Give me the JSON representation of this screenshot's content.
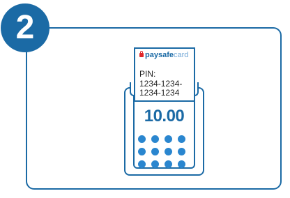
{
  "step": {
    "number": "2"
  },
  "receipt": {
    "logo_bold": "paysafe",
    "logo_light": "card",
    "pin_label": "PIN:",
    "pin_value": "1234-1234-\n1234-1234"
  },
  "terminal": {
    "amount": "10.00",
    "keypad_keys": 12
  },
  "colors": {
    "primary": "#1b6aa5",
    "key": "#2a86cf",
    "lock": "#e0262a"
  }
}
